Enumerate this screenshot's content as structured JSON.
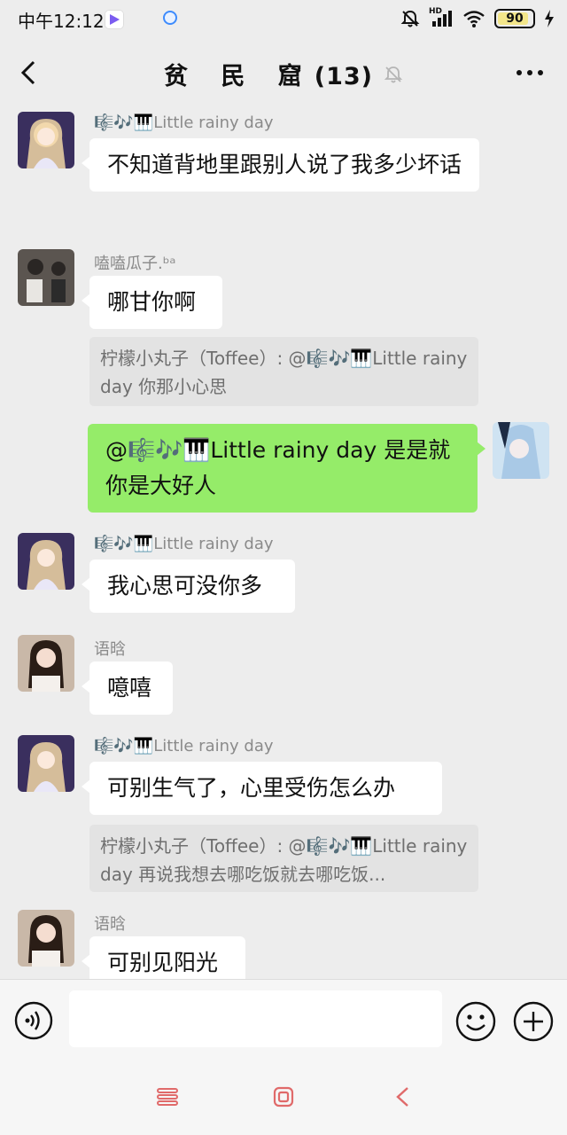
{
  "status_bar": {
    "time": "中午12:12",
    "battery": "90",
    "network_badge": "HD"
  },
  "header": {
    "title_name": "贫 民 窟",
    "member_count": "(13)"
  },
  "messages": [
    {
      "sender": "🎼🎶🎹Little rainy day",
      "text": "不知道背地里跟别人说了我多少坏话"
    },
    {
      "sender": "嗑嗑瓜子.ᵇᵃ",
      "text": "哪甘你啊",
      "quote": "柠檬小丸子（Toffee）: @🎼🎶🎹Little rainy day 你那小心思"
    },
    {
      "sender": "",
      "text": "@🎼🎶🎹Little rainy day  是是就你是大好人",
      "self": true
    },
    {
      "sender": "🎼🎶🎹Little rainy day",
      "text": "我心思可没你多"
    },
    {
      "sender": "语晗",
      "text": "噫嘻"
    },
    {
      "sender": "🎼🎶🎹Little rainy day",
      "text": "可别生气了，心里受伤怎么办",
      "quote": "柠檬小丸子（Toffee）: @🎼🎶🎹Little rainy day 再说我想去哪吃饭就去哪吃饭..."
    },
    {
      "sender": "语晗",
      "text": "可别见阳光"
    }
  ],
  "input": {
    "value": "",
    "placeholder": ""
  },
  "colors": {
    "background": "#ededed",
    "self_bubble": "#95ec69",
    "other_bubble": "#ffffff",
    "quote_bg": "#e3e3e3",
    "nav_accent": "#e06a6a"
  },
  "icons": [
    "back-arrow-icon",
    "bell-off-icon",
    "more-dots-icon",
    "voice-icon",
    "emoji-icon",
    "plus-icon",
    "menu-icon",
    "home-icon",
    "back-nav-icon"
  ]
}
